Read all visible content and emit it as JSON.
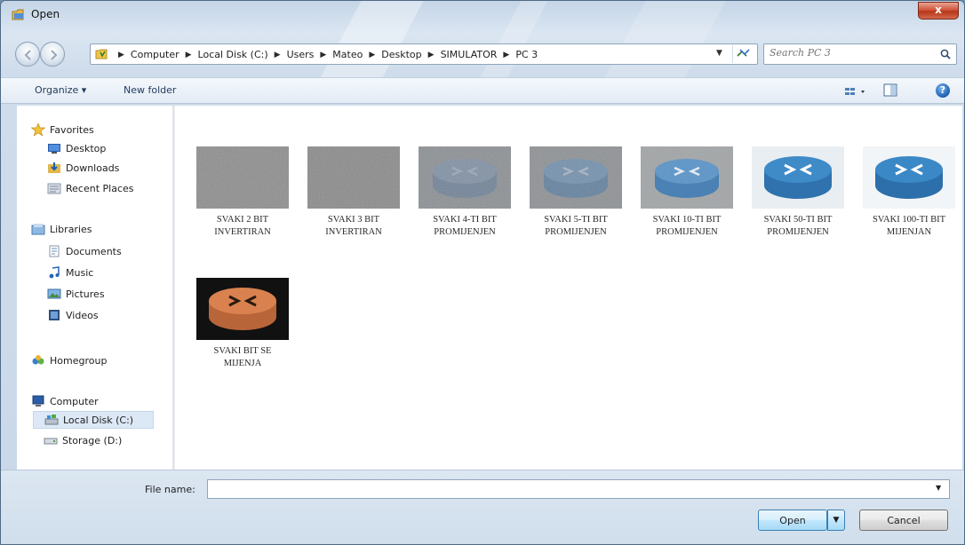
{
  "window": {
    "title": "Open",
    "close_label": "x"
  },
  "address": {
    "crumbs": [
      "Computer",
      "Local Disk (C:)",
      "Users",
      "Mateo",
      "Desktop",
      "SIMULATOR",
      "PC 3"
    ],
    "search_placeholder": "Search PC 3"
  },
  "toolbar": {
    "organize_label": "Organize ▾",
    "new_folder_label": "New folder",
    "help_label": "?"
  },
  "nav": {
    "items": [
      {
        "label": "Favorites",
        "icon": "star-icon"
      },
      {
        "label": "Desktop",
        "icon": "desktop-icon"
      },
      {
        "label": "Downloads",
        "icon": "downloads-icon"
      },
      {
        "label": "Recent Places",
        "icon": "recent-places-icon"
      },
      {
        "label": "Libraries",
        "icon": "libraries-icon"
      },
      {
        "label": "Documents",
        "icon": "documents-icon"
      },
      {
        "label": "Music",
        "icon": "music-icon"
      },
      {
        "label": "Pictures",
        "icon": "pictures-icon"
      },
      {
        "label": "Videos",
        "icon": "videos-icon"
      },
      {
        "label": "Homegroup",
        "icon": "homegroup-icon"
      },
      {
        "label": "Computer",
        "icon": "computer-icon"
      },
      {
        "label": "Local Disk (C:)",
        "icon": "local-disk-icon"
      },
      {
        "label": "Storage (D:)",
        "icon": "storage-drive-icon"
      }
    ],
    "selected": "Local Disk (C:)"
  },
  "files": [
    {
      "line1": "SVAKI 2 BIT",
      "line2": "INVERTIRAN",
      "style": "noise"
    },
    {
      "line1": "SVAKI 3 BIT",
      "line2": "INVERTIRAN",
      "style": "noise"
    },
    {
      "line1": "SVAKI 4-TI BIT",
      "line2": "PROMIJENJEN",
      "style": "faint-router"
    },
    {
      "line1": "SVAKI 5-TI BIT",
      "line2": "PROMIJENJEN",
      "style": "faint-router"
    },
    {
      "line1": "SVAKI 10-TI BIT",
      "line2": "PROMIJENJEN",
      "style": "mid-router"
    },
    {
      "line1": "SVAKI 50-TI BIT",
      "line2": "PROMIJENJEN",
      "style": "blue-router"
    },
    {
      "line1": "SVAKI 100-TI BIT",
      "line2": "MIJENJAN",
      "style": "blue-router"
    },
    {
      "line1": "SVAKI BIT SE",
      "line2": "MIJENJA",
      "style": "orange-router"
    }
  ],
  "bottom": {
    "file_name_label": "File name:",
    "file_name_value": "",
    "open_label": "Open",
    "cancel_label": "Cancel"
  },
  "colors": {
    "router_blue": "#2f7fc0",
    "router_orange": "#d9824f",
    "noise_gray": "#8d8d8d"
  }
}
